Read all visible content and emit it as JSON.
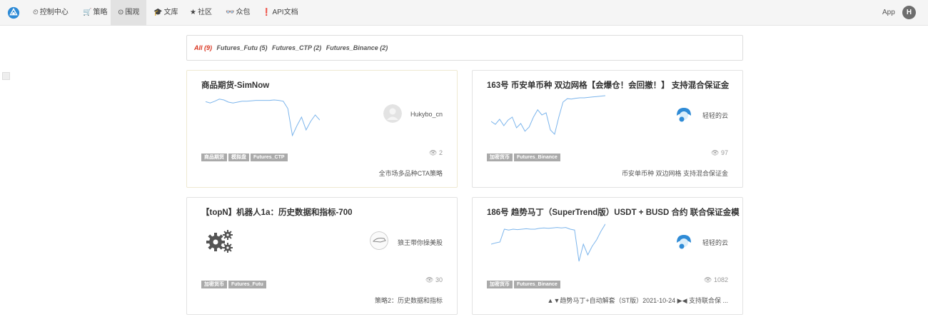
{
  "nav": {
    "items": [
      {
        "icon": "⏲",
        "label": "控制中心"
      },
      {
        "icon": "🛒",
        "label": "策略"
      },
      {
        "icon": "⊙",
        "label": "围观"
      },
      {
        "icon": "🎓",
        "label": "文库"
      },
      {
        "icon": "★",
        "label": "社区"
      },
      {
        "icon": "👓",
        "label": "众包"
      },
      {
        "icon": "❗",
        "label": "API文档"
      }
    ],
    "active_index": 2,
    "app_label": "App",
    "user_initial": "H"
  },
  "filters": [
    {
      "label": "All (9)",
      "active": true
    },
    {
      "label": "Futures_Futu (5)",
      "active": false
    },
    {
      "label": "Futures_CTP (2)",
      "active": false
    },
    {
      "label": "Futures_Binance (2)",
      "active": false
    }
  ],
  "cards": [
    {
      "title": "商品期货-SimNow",
      "owner": "Hukybo_cn",
      "avatar": "grey-avatar",
      "tags": [
        "商品期货",
        "模拟盘",
        "Futures_CTP"
      ],
      "views": "2",
      "description": "全市场多品种CTA策略",
      "curve": [
        0.19,
        0.22,
        0.18,
        0.13,
        0.15,
        0.2,
        0.22,
        0.2,
        0.18,
        0.18,
        0.17,
        0.16,
        0.16,
        0.16,
        0.16,
        0.15,
        0.16,
        0.18,
        0.35,
        0.98,
        0.75,
        0.55,
        0.85,
        0.65,
        0.5,
        0.62
      ]
    },
    {
      "title": "163号 币安单币种 双边网格【会爆仓！会回撤！】 支持混合保证金",
      "owner": "轻轻的云",
      "avatar": "cloud-avatar",
      "tags": [
        "加密货币",
        "Futures_Binance"
      ],
      "views": "97",
      "description": "币安单币种 双边网格 支持混合保证金",
      "curve": [
        0.65,
        0.72,
        0.6,
        0.75,
        0.62,
        0.55,
        0.8,
        0.7,
        0.88,
        0.78,
        0.55,
        0.38,
        0.5,
        0.45,
        0.85,
        0.95,
        0.55,
        0.2,
        0.12,
        0.13,
        0.11,
        0.1,
        0.1,
        0.09,
        0.08,
        0.07,
        0.06,
        0.05
      ]
    },
    {
      "title": "【topN】机器人1a：历史数据和指标-700",
      "owner": "狼王带你操美股",
      "avatar": "wolf-avatar",
      "tags": [
        "加密货币",
        "Futures_Futu"
      ],
      "views": "30",
      "description": "策略2：历史数据和指标",
      "curve": []
    },
    {
      "title": "186号 趋势马丁（SuperTrend版）USDT + BUSD 合约 联合保证金模",
      "owner": "轻轻的云",
      "avatar": "cloud-avatar",
      "tags": [
        "加密货币",
        "Futures_Binance"
      ],
      "views": "1082",
      "description": "▲▼趋势马丁+自动解套（ST版）2021-10-24 ▶◀ 支持联合保 ...",
      "curve": [
        0.55,
        0.52,
        0.5,
        0.2,
        0.22,
        0.2,
        0.21,
        0.2,
        0.19,
        0.2,
        0.2,
        0.18,
        0.17,
        0.18,
        0.17,
        0.16,
        0.17,
        0.16,
        0.2,
        0.22,
        0.95,
        0.55,
        0.8,
        0.6,
        0.45,
        0.25,
        0.08
      ]
    }
  ]
}
